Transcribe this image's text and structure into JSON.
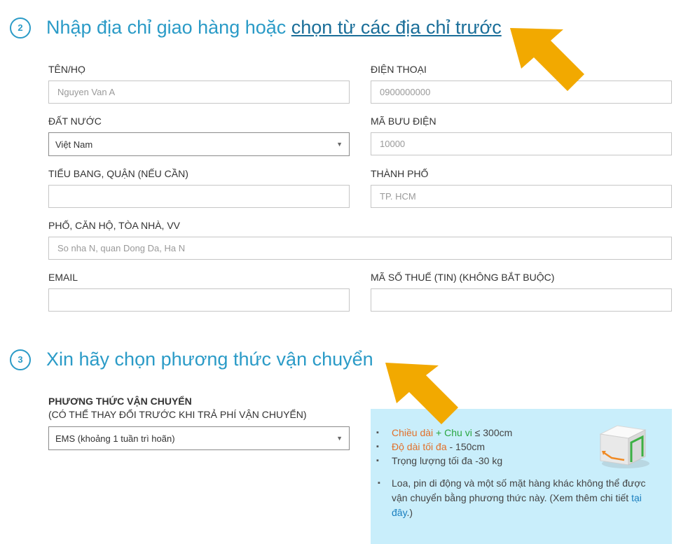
{
  "step2": {
    "number": "2",
    "title": "Nhập địa chỉ giao hàng hoặc ",
    "link": "chọn từ các địa chỉ trước"
  },
  "form": {
    "name_label": "TÊN/HỌ",
    "name_placeholder": "Nguyen Van A",
    "phone_label": "ĐIỆN THOẠI",
    "phone_placeholder": "0900000000",
    "country_label": "ĐẤT NƯỚC",
    "country_value": "Việt Nam",
    "postal_label": "MÃ BƯU ĐIỆN",
    "postal_placeholder": "10000",
    "state_label": "TIỂU BANG, QUẬN (NẾU CẦN)",
    "state_placeholder": "",
    "city_label": "THÀNH PHỐ",
    "city_placeholder": "TP. HCM",
    "street_label": "PHỐ, CĂN HỘ, TÒA NHÀ, VV",
    "street_placeholder": "So nha N, quan Dong Da, Ha N",
    "email_label": "EMAIL",
    "email_placeholder": "",
    "tax_label": "MÃ SỐ THUẾ (TIN) (KHÔNG BẮT BUỘC)",
    "tax_placeholder": ""
  },
  "step3": {
    "number": "3",
    "title": "Xin hãy chọn phương thức vận chuyển"
  },
  "shipping": {
    "label": "PHƯƠNG THỨC VẬN CHUYỂN",
    "sublabel": "(CÓ THỂ THAY ĐỔI TRƯỚC KHI TRẢ PHÍ VẬN CHUYỂN)",
    "selected": "EMS (khoảng 1 tuần trì hoãn)"
  },
  "info": {
    "length_label": "Chiều dài",
    "plus": " + ",
    "girth_label": "Chu vi",
    "limit1": " ≤ 300cm",
    "maxlen_label": "Độ dài tối đa",
    "limit2": " - 150cm",
    "weight": "Trọng lượng tối đa -30 kg",
    "note": "Loa, pin di động và một số mặt hàng khác không thể được vận chuyển bằng phương thức này. (Xem thêm chi tiết ",
    "note_link": "tại đây",
    "note_end": ".)"
  },
  "colors": {
    "accent": "#2b9bc7",
    "arrow": "#f2a900",
    "info_bg": "#c9eefb"
  }
}
